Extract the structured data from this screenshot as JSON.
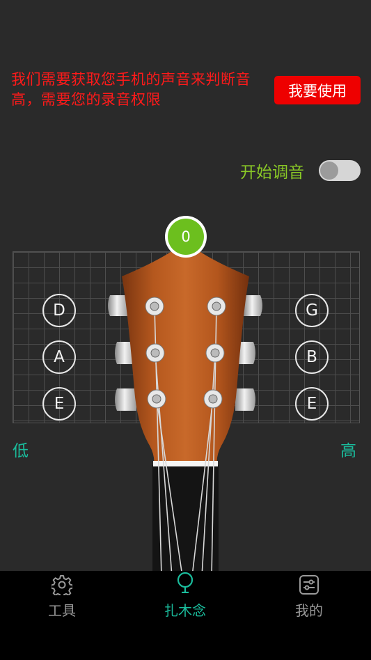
{
  "permission": {
    "message": "我们需要获取您手机的声音来判断音高，需要您的录音权限",
    "button_label": "我要使用"
  },
  "tuning": {
    "start_label": "开始调音",
    "switch_on": false,
    "pitch_value": "0"
  },
  "strings": {
    "left": [
      "D",
      "A",
      "E"
    ],
    "right": [
      "G",
      "B",
      "E"
    ]
  },
  "scale": {
    "low_label": "低",
    "high_label": "高"
  },
  "nav": {
    "items": [
      {
        "label": "工具",
        "icon": "gear-icon",
        "active": false
      },
      {
        "label": "扎木念",
        "icon": "tuner-icon",
        "active": true
      },
      {
        "label": "我的",
        "icon": "profile-icon",
        "active": false
      }
    ]
  },
  "colors": {
    "accent_green": "#8ac926",
    "nav_active": "#1abc9c",
    "warning_red": "#ff1a1a",
    "button_red": "#ee0000"
  }
}
